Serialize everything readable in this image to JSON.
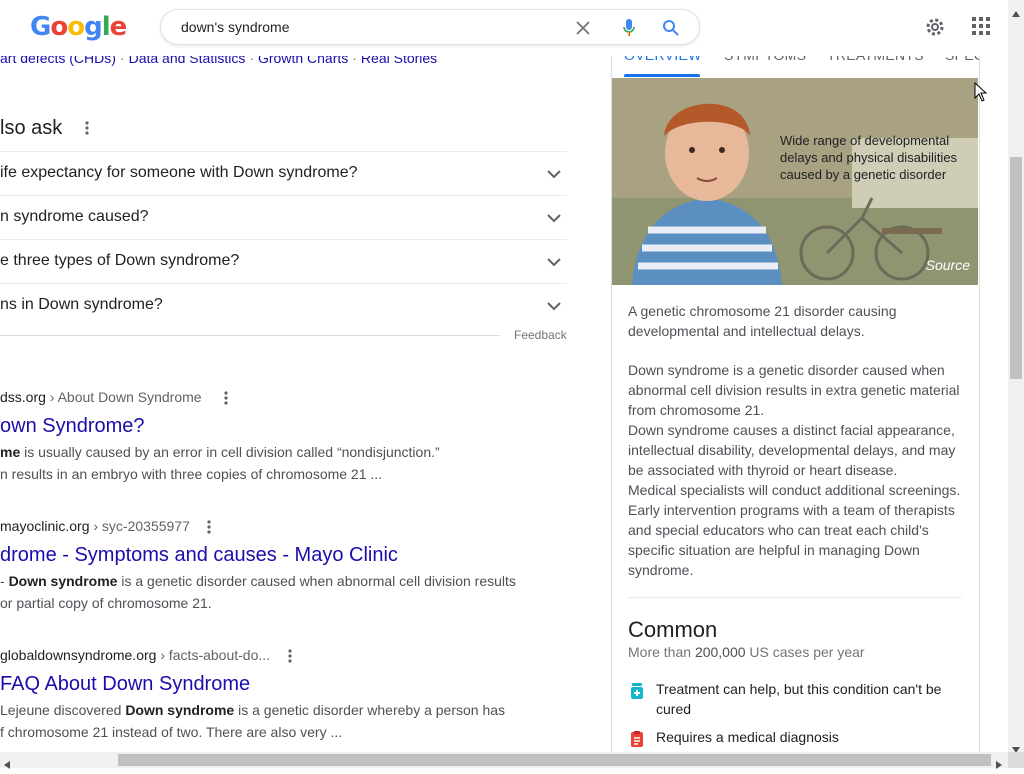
{
  "header": {
    "logo_text": "Google",
    "search_query": "down's syndrome"
  },
  "chips": [
    "art defects (CHDs)",
    "Data and Statistics",
    "Growth Charts",
    "Real Stories"
  ],
  "paa": {
    "title": "lso ask",
    "questions": [
      "ife expectancy for someone with Down syndrome?",
      "n syndrome caused?",
      "e three types of Down syndrome?",
      "ns in Down syndrome?"
    ],
    "feedback": "Feedback"
  },
  "results": [
    {
      "site": "dss.org",
      "crumb": " › About Down Syndrome",
      "title": "own Syndrome?",
      "snippet1_bold": "me",
      "snippet1_rest": " is usually caused by an error in cell division called “nondisjunction.”",
      "snippet2": "n results in an embryo with three copies of chromosome 21 ..."
    },
    {
      "site": "mayoclinic.org",
      "crumb": " › syc-20355977",
      "title": "drome - Symptoms and causes - Mayo Clinic",
      "snippet1_pre": "- ",
      "snippet1_bold": "Down syndrome",
      "snippet1_rest": " is a genetic disorder caused when abnormal cell division results",
      "snippet2": " or partial copy of chromosome 21."
    },
    {
      "site": "globaldownsyndrome.org",
      "crumb": " › facts-about-do...",
      "title": " FAQ About Down Syndrome",
      "snippet1_pre": "Lejeune discovered ",
      "snippet1_bold": "Down syndrome",
      "snippet1_rest": " is a genetic disorder whereby a person has",
      "snippet2": "f chromosome 21 instead of two. There are also very ..."
    }
  ],
  "panel": {
    "tabs": [
      "OVERVIEW",
      "SYMPTOMS",
      "TREATMENTS",
      "SPEC"
    ],
    "image_caption": "Wide range of developmental delays and physical disabilities caused by a genetic disorder",
    "image_source": "Source",
    "summary": "A genetic chromosome 21 disorder causing developmental and intellectual delays.",
    "description": "Down syndrome is a genetic disorder caused when abnormal cell division results in extra genetic material from chromosome 21.",
    "description2": "Down syndrome causes a distinct facial appearance, intellectual disability, developmental delays, and may be associated with thyroid or heart disease.",
    "description3": "Medical specialists will conduct additional screenings. Early intervention programs with a team of therapists and special educators who can treat each child's specific situation are helpful in managing Down syndrome.",
    "common_heading": "Common",
    "common_sub_pre": "More than ",
    "common_sub_bold": "200,000",
    "common_sub_post": " US cases per year",
    "facts": [
      {
        "icon": "medicine-bottle-icon",
        "text": "Treatment can help, but this condition can't be cured"
      },
      {
        "icon": "clipboard-icon",
        "text": "Requires a medical diagnosis"
      }
    ]
  },
  "colors": {
    "link": "#1a0dab",
    "accent": "#1a73e8"
  }
}
